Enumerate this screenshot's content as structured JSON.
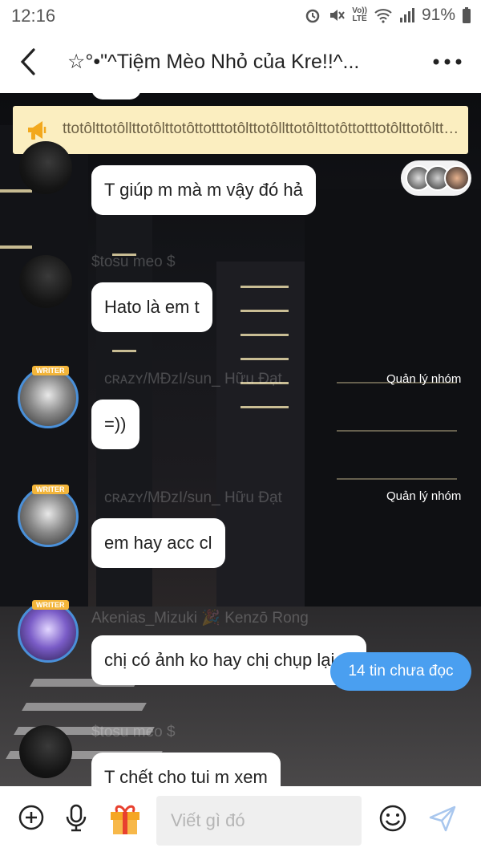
{
  "status_bar": {
    "time": "12:16",
    "battery": "91%",
    "volte_line1": "Vo))",
    "volte_line2": "LTE"
  },
  "header": {
    "title": "☆°•\"^Tiệm Mèo Nhỏ của Kre!!^..."
  },
  "announcement": {
    "text": "ttotôlttotôllttotôlttotôttotttotôlttotôllttotôlttotôttotttotôlttotôlttotôttottto"
  },
  "messages": [
    {
      "text": "T giúp m mà m vậy đó hả"
    },
    {
      "author": "$tosu meo $",
      "text": "Hato là em t"
    },
    {
      "author": "ᴄʀᴀᴢʏ/MĐzI/sun_ Hữu Đạt",
      "role": "Quản lý nhóm",
      "text": "=))"
    },
    {
      "author": "ᴄʀᴀᴢʏ/MĐzI/sun_ Hữu Đạt",
      "role": "Quản lý nhóm",
      "text": "em hay acc cl"
    },
    {
      "author": "Akenias_Mizuki 🎉 Kenzō Rong",
      "text": "chị có ảnh ko hay chị chụp lại đi"
    },
    {
      "author": "$tosu meo $",
      "text": "T chết cho tui m xem"
    }
  ],
  "badges": {
    "writer": "WRITER"
  },
  "unread_button": {
    "label": "14 tin chưa đọc"
  },
  "input": {
    "placeholder": "Viết gì đó"
  },
  "icons": [
    "back-arrow-icon",
    "more-dots-icon",
    "megaphone-icon",
    "plus-circle-icon",
    "microphone-icon",
    "gift-icon",
    "smiley-icon",
    "send-icon"
  ],
  "colors": {
    "accent": "#4a9ff0",
    "announcement_bg": "#fbeec0",
    "bubble_bg": "#ffffff",
    "writer_ring": "#4a90d9"
  }
}
